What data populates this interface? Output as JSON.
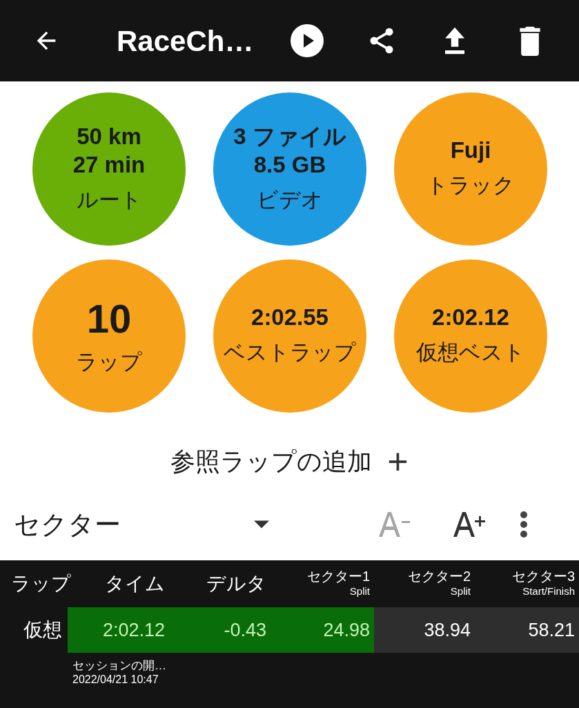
{
  "app_bar": {
    "title": "RaceCh…"
  },
  "stats": [
    {
      "kind": "stat",
      "color": "#6aaf08",
      "values": [
        "50 km",
        "27 min"
      ],
      "label": "ルート"
    },
    {
      "kind": "stat",
      "color": "#1e9be0",
      "values": [
        "3 ファイル",
        "8.5 GB"
      ],
      "label": "ビデオ"
    },
    {
      "kind": "stat",
      "color": "#f7a21b",
      "values": [
        "Fuji"
      ],
      "label": "トラック"
    },
    {
      "kind": "count",
      "color": "#f7a21b",
      "values": [
        "10"
      ],
      "label": "ラップ"
    },
    {
      "kind": "stat",
      "color": "#f7a21b",
      "values": [
        "2:02.55"
      ],
      "label": "ベストラップ"
    },
    {
      "kind": "stat",
      "color": "#f7a21b",
      "values": [
        "2:02.12"
      ],
      "label": "仮想ベスト"
    }
  ],
  "add_reference": {
    "label": "参照ラップの追加",
    "icon": "+"
  },
  "toolbar": {
    "selector": "セクター",
    "font_decrease": {
      "disabled": true
    },
    "font_increase": {
      "disabled": false
    }
  },
  "table": {
    "columns": [
      {
        "title": "ラップ"
      },
      {
        "title": "タイム"
      },
      {
        "title": "デルタ"
      },
      {
        "title": "セクター1",
        "subtitle": "Split"
      },
      {
        "title": "セクター2",
        "subtitle": "Split"
      },
      {
        "title": "セクター3",
        "subtitle": "Start/Finish"
      }
    ],
    "rows": [
      {
        "cells": [
          {
            "text": "仮想"
          },
          {
            "text": "2:02.12",
            "highlighted": true
          },
          {
            "text": "-0.43",
            "highlighted": true
          },
          {
            "text": "24.98",
            "highlighted": true
          },
          {
            "text": "38.94",
            "highlighted": false
          },
          {
            "text": "58.21",
            "highlighted": false
          }
        ],
        "note": "セッションの開…",
        "date": "2022/04/21 10:47"
      }
    ]
  }
}
